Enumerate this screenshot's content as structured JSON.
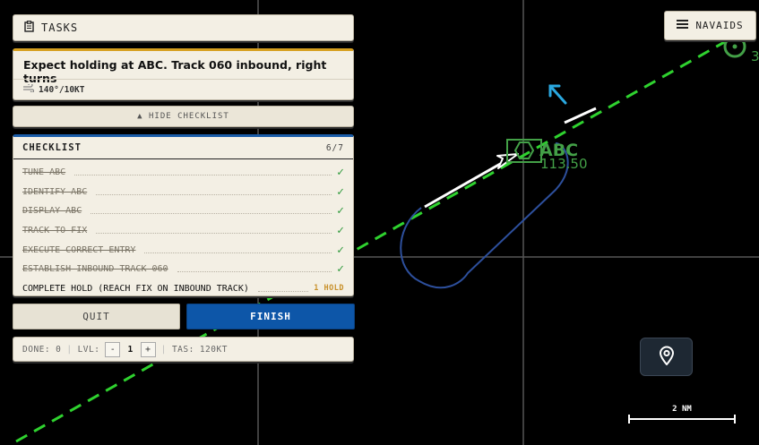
{
  "tasks": {
    "label": "TASKS",
    "icon": "clipboard-icon"
  },
  "task": {
    "title": "Expect holding at ABC. Track 060 inbound, right turns",
    "wind": "140°/10KT",
    "wind_icon": "wind-icon"
  },
  "checklist": {
    "hide_label": "▲ HIDE CHECKLIST",
    "title": "CHECKLIST",
    "progress": "6/7",
    "items": [
      {
        "label": "TUNE ABC",
        "done": true
      },
      {
        "label": "IDENTIFY ABC",
        "done": true
      },
      {
        "label": "DISPLAY ABC",
        "done": true
      },
      {
        "label": "TRACK TO FIX",
        "done": true
      },
      {
        "label": "EXECUTE CORRECT ENTRY",
        "done": true
      },
      {
        "label": "ESTABLISH INBOUND TRACK 060",
        "done": true
      },
      {
        "label": "COMPLETE HOLD (REACH FIX ON INBOUND TRACK)",
        "done": false,
        "badge": "1 HOLD"
      }
    ],
    "check_mark": "✓"
  },
  "buttons": {
    "quit": "QUIT",
    "finish": "FINISH"
  },
  "status": {
    "done_label": "DONE:",
    "done_value": "0",
    "lvl_label": "LVL:",
    "lvl_minus": "-",
    "lvl_value": "1",
    "lvl_plus": "+",
    "tas_label": "TAS:",
    "tas_value": "120KT",
    "separator": "|"
  },
  "navaids": {
    "label": "NAVAIDS",
    "icon": "menu-icon"
  },
  "map": {
    "station_id": "ABC",
    "station_freq": "113.50",
    "scale_label": "2 NM",
    "partial_label": "3",
    "colors": {
      "track": "#2fd22f",
      "station": "#43a047",
      "hold": "#2d4f9c",
      "aircraft": "#ffffff",
      "wind_arrow": "#2aa8e0",
      "grid": "#555555",
      "finish": "#0d56a8",
      "task_accent": "#d7a020"
    }
  },
  "location_button": {
    "icon": "location-pin-icon"
  }
}
